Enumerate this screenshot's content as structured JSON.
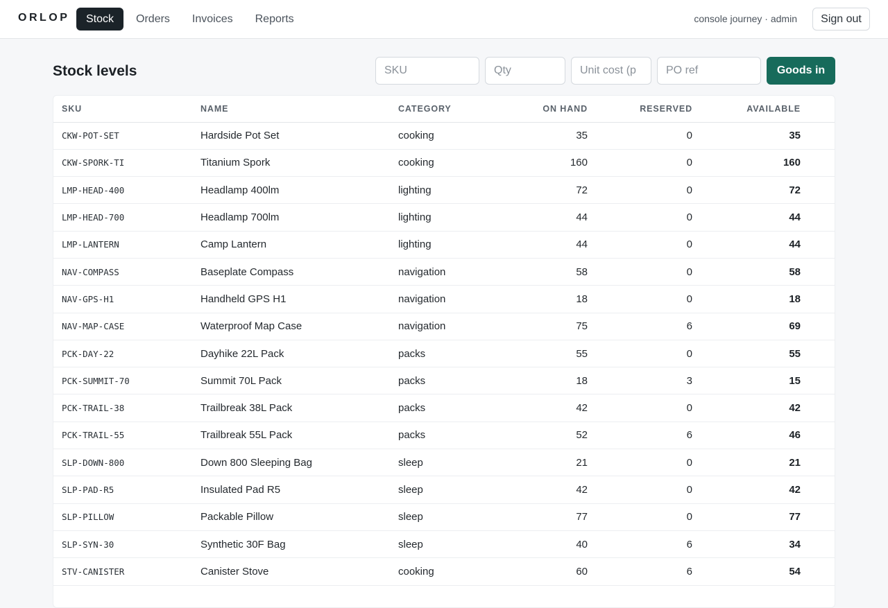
{
  "app": {
    "brand": "ORLOP"
  },
  "nav": {
    "items": [
      "Stock",
      "Orders",
      "Invoices",
      "Reports"
    ],
    "active": "Stock"
  },
  "user": {
    "label": "console journey · admin",
    "signout_label": "Sign out"
  },
  "page": {
    "title": "Stock levels"
  },
  "form": {
    "sku_placeholder": "SKU",
    "qty_placeholder": "Qty",
    "cost_placeholder": "Unit cost (p",
    "po_placeholder": "PO ref",
    "submit_label": "Goods in"
  },
  "table": {
    "headers": {
      "sku": "SKU",
      "name": "NAME",
      "category": "CATEGORY",
      "on_hand": "ON HAND",
      "reserved": "RESERVED",
      "available": "AVAILABLE"
    },
    "rows": [
      {
        "sku": "CKW-POT-SET",
        "name": "Hardside Pot Set",
        "category": "cooking",
        "on_hand": "35",
        "reserved": "0",
        "available": "35"
      },
      {
        "sku": "CKW-SPORK-TI",
        "name": "Titanium Spork",
        "category": "cooking",
        "on_hand": "160",
        "reserved": "0",
        "available": "160"
      },
      {
        "sku": "LMP-HEAD-400",
        "name": "Headlamp 400lm",
        "category": "lighting",
        "on_hand": "72",
        "reserved": "0",
        "available": "72"
      },
      {
        "sku": "LMP-HEAD-700",
        "name": "Headlamp 700lm",
        "category": "lighting",
        "on_hand": "44",
        "reserved": "0",
        "available": "44"
      },
      {
        "sku": "LMP-LANTERN",
        "name": "Camp Lantern",
        "category": "lighting",
        "on_hand": "44",
        "reserved": "0",
        "available": "44"
      },
      {
        "sku": "NAV-COMPASS",
        "name": "Baseplate Compass",
        "category": "navigation",
        "on_hand": "58",
        "reserved": "0",
        "available": "58"
      },
      {
        "sku": "NAV-GPS-H1",
        "name": "Handheld GPS H1",
        "category": "navigation",
        "on_hand": "18",
        "reserved": "0",
        "available": "18"
      },
      {
        "sku": "NAV-MAP-CASE",
        "name": "Waterproof Map Case",
        "category": "navigation",
        "on_hand": "75",
        "reserved": "6",
        "available": "69"
      },
      {
        "sku": "PCK-DAY-22",
        "name": "Dayhike 22L Pack",
        "category": "packs",
        "on_hand": "55",
        "reserved": "0",
        "available": "55"
      },
      {
        "sku": "PCK-SUMMIT-70",
        "name": "Summit 70L Pack",
        "category": "packs",
        "on_hand": "18",
        "reserved": "3",
        "available": "15"
      },
      {
        "sku": "PCK-TRAIL-38",
        "name": "Trailbreak 38L Pack",
        "category": "packs",
        "on_hand": "42",
        "reserved": "0",
        "available": "42"
      },
      {
        "sku": "PCK-TRAIL-55",
        "name": "Trailbreak 55L Pack",
        "category": "packs",
        "on_hand": "52",
        "reserved": "6",
        "available": "46"
      },
      {
        "sku": "SLP-DOWN-800",
        "name": "Down 800 Sleeping Bag",
        "category": "sleep",
        "on_hand": "21",
        "reserved": "0",
        "available": "21"
      },
      {
        "sku": "SLP-PAD-R5",
        "name": "Insulated Pad R5",
        "category": "sleep",
        "on_hand": "42",
        "reserved": "0",
        "available": "42"
      },
      {
        "sku": "SLP-PILLOW",
        "name": "Packable Pillow",
        "category": "sleep",
        "on_hand": "77",
        "reserved": "0",
        "available": "77"
      },
      {
        "sku": "SLP-SYN-30",
        "name": "Synthetic 30F Bag",
        "category": "sleep",
        "on_hand": "40",
        "reserved": "6",
        "available": "34"
      },
      {
        "sku": "STV-CANISTER",
        "name": "Canister Stove",
        "category": "cooking",
        "on_hand": "60",
        "reserved": "6",
        "available": "54"
      }
    ]
  }
}
